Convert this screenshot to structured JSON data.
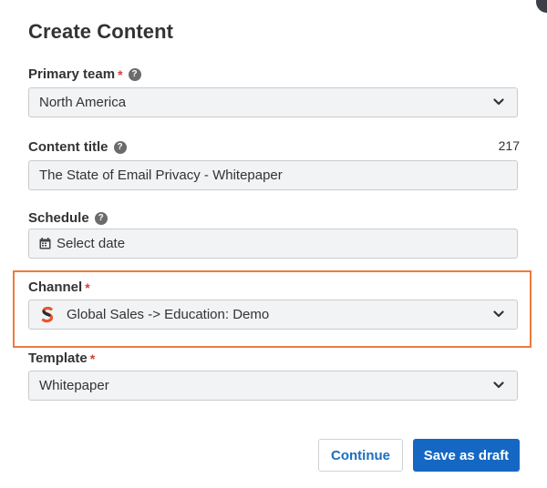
{
  "title": "Create Content",
  "fields": {
    "primary_team": {
      "label": "Primary team",
      "required_mark": "*",
      "help_icon": "?",
      "value": "North America"
    },
    "content_title": {
      "label": "Content title",
      "help_icon": "?",
      "value": "The State of Email Privacy - Whitepaper",
      "remaining_chars": "217"
    },
    "schedule": {
      "label": "Schedule",
      "help_icon": "?",
      "placeholder": "Select date"
    },
    "channel": {
      "label": "Channel",
      "required_mark": "*",
      "value": "Global Sales -> Education: Demo",
      "highlight_color": "#ee7a3d"
    },
    "template": {
      "label": "Template",
      "required_mark": "*",
      "value": "Whitepaper"
    }
  },
  "buttons": {
    "continue_label": "Continue",
    "save_draft_label": "Save as draft"
  },
  "colors": {
    "primary": "#1468c4",
    "required": "#d93b3b",
    "highlight": "#ee7a3d",
    "logo": "#e8542f"
  },
  "icons": {
    "help": "question-circle-icon",
    "calendar": "calendar-icon",
    "dropdown": "chevron-down-icon",
    "channel_logo": "s-logo-icon"
  }
}
